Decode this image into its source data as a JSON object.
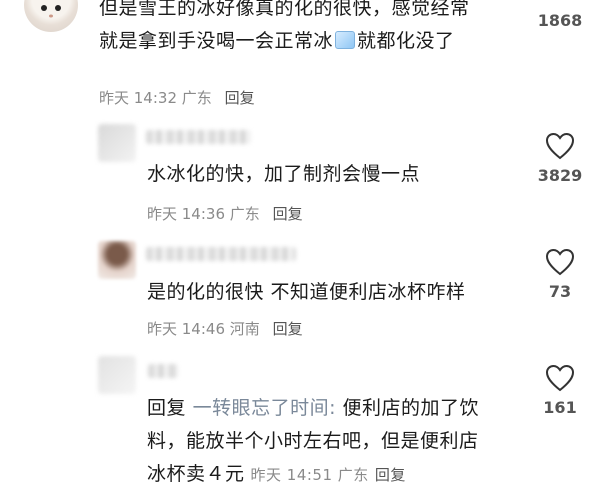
{
  "comments": [
    {
      "text_line1": "但是雪王的冰好像真的化的很快，感觉经常",
      "text_line2a": "就是拿到手没喝一会正常冰",
      "ice_emoji": "ice-cube-icon",
      "text_line2b": "就都化没了",
      "time": "昨天 14:32",
      "location": "广东",
      "reply_label": "回复",
      "likes": "1868"
    },
    {
      "text": "水冰化的快，加了制剂会慢一点",
      "time": "昨天 14:36",
      "location": "广东",
      "reply_label": "回复",
      "likes": "3829"
    },
    {
      "text": "是的化的很快 不知道便利店冰杯咋样",
      "time": "昨天 14:46",
      "location": "河南",
      "reply_label": "回复",
      "likes": "73"
    },
    {
      "reply_prefix": "回复",
      "mention": "一转眼忘了时间:",
      "text_line1": "便利店的加了饮",
      "text_line2": "料，能放半个小时左右吧，但是便利店",
      "text_line3": "冰杯卖４元",
      "time": "昨天 14:51",
      "location": "广东",
      "reply_label": "回复",
      "likes": "161"
    }
  ],
  "colors": {
    "heart_stroke": "#333333",
    "meta": "#8a8a8a"
  }
}
